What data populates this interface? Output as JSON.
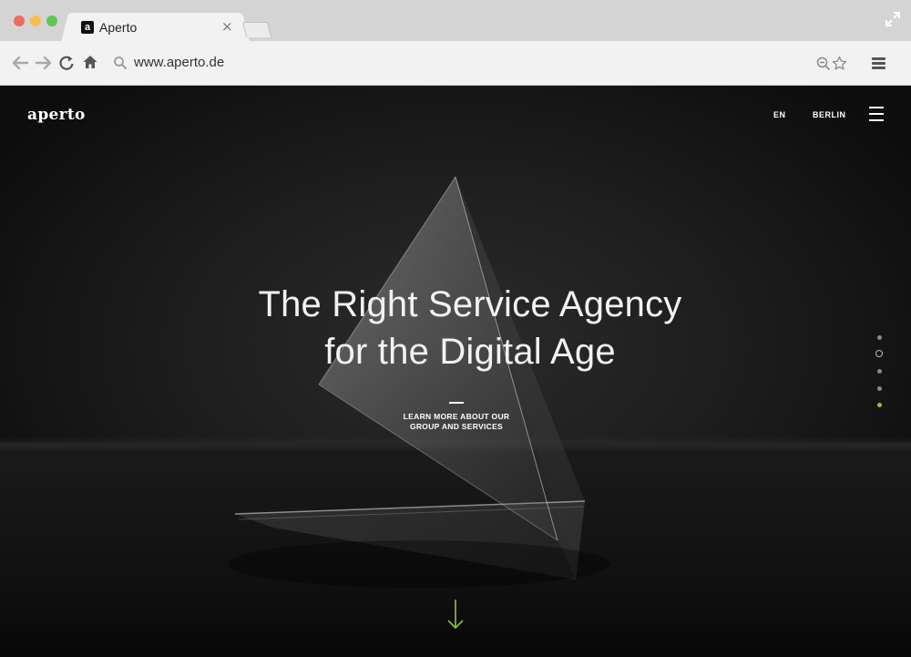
{
  "browser": {
    "tab": {
      "favicon": "a",
      "title": "Aperto",
      "close": "×"
    },
    "address": {
      "url": "www.aperto.de"
    },
    "icons": [
      "back-arrow-icon",
      "forward-arrow-icon",
      "reload-icon",
      "home-icon",
      "search-icon",
      "zoom-icon",
      "star-icon",
      "menu-icon",
      "expand-icon"
    ]
  },
  "site": {
    "logo": "aperto",
    "nav": {
      "language": "EN",
      "city": "BERLIN",
      "menu_icon": "hamburger-icon"
    },
    "hero": {
      "headline_line1": "The Right Service Agency",
      "headline_line2": "for the Digital Age",
      "cta_line1": "LEARN MORE ABOUT OUR",
      "cta_line2": "GROUP AND SERVICES"
    },
    "pager": {
      "count": 5,
      "active_index": 1,
      "accent_index": 4
    },
    "scroll_icon": "down-arrow-icon"
  },
  "colors": {
    "background": "#1c1c1c",
    "text": "#ffffff",
    "accent": "#8cc63f"
  }
}
